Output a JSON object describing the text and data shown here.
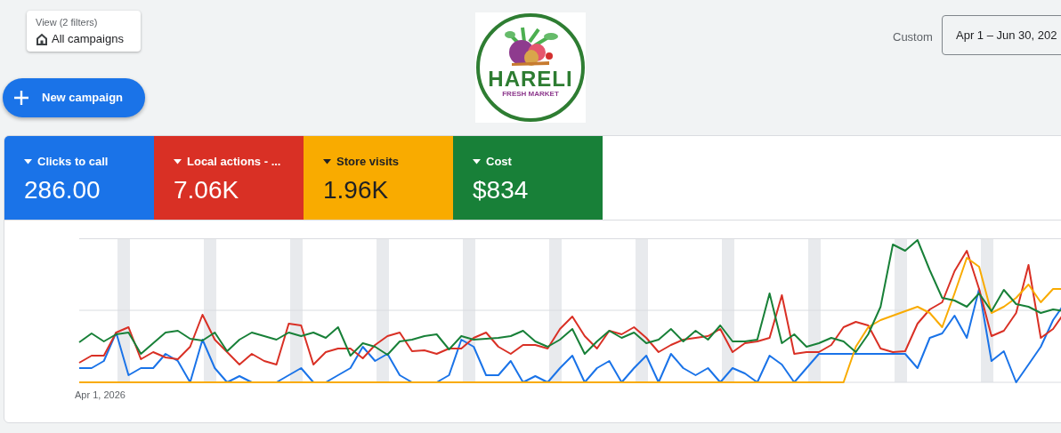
{
  "view_filter": {
    "caption": "View (2 filters)",
    "label": "All campaigns"
  },
  "new_campaign_button": {
    "label": "New campaign"
  },
  "logo": {
    "name": "HARELI",
    "tagline": "FRESH MARKET"
  },
  "date_range": {
    "label": "Custom",
    "value": "Apr 1 – Jun 30, 202"
  },
  "metrics": [
    {
      "label": "Clicks to call",
      "value": "286.00",
      "color": "#1a73e8",
      "selected": true
    },
    {
      "label": "Local actions - ...",
      "value": "7.06K",
      "color": "#d93025",
      "selected": true
    },
    {
      "label": "Store visits",
      "value": "1.96K",
      "color": "#f9ab00",
      "selected": true
    },
    {
      "label": "Cost",
      "value": "$834",
      "color": "#188038",
      "selected": true
    }
  ],
  "chart": {
    "x_start_label": "Apr 1, 2026"
  }
}
